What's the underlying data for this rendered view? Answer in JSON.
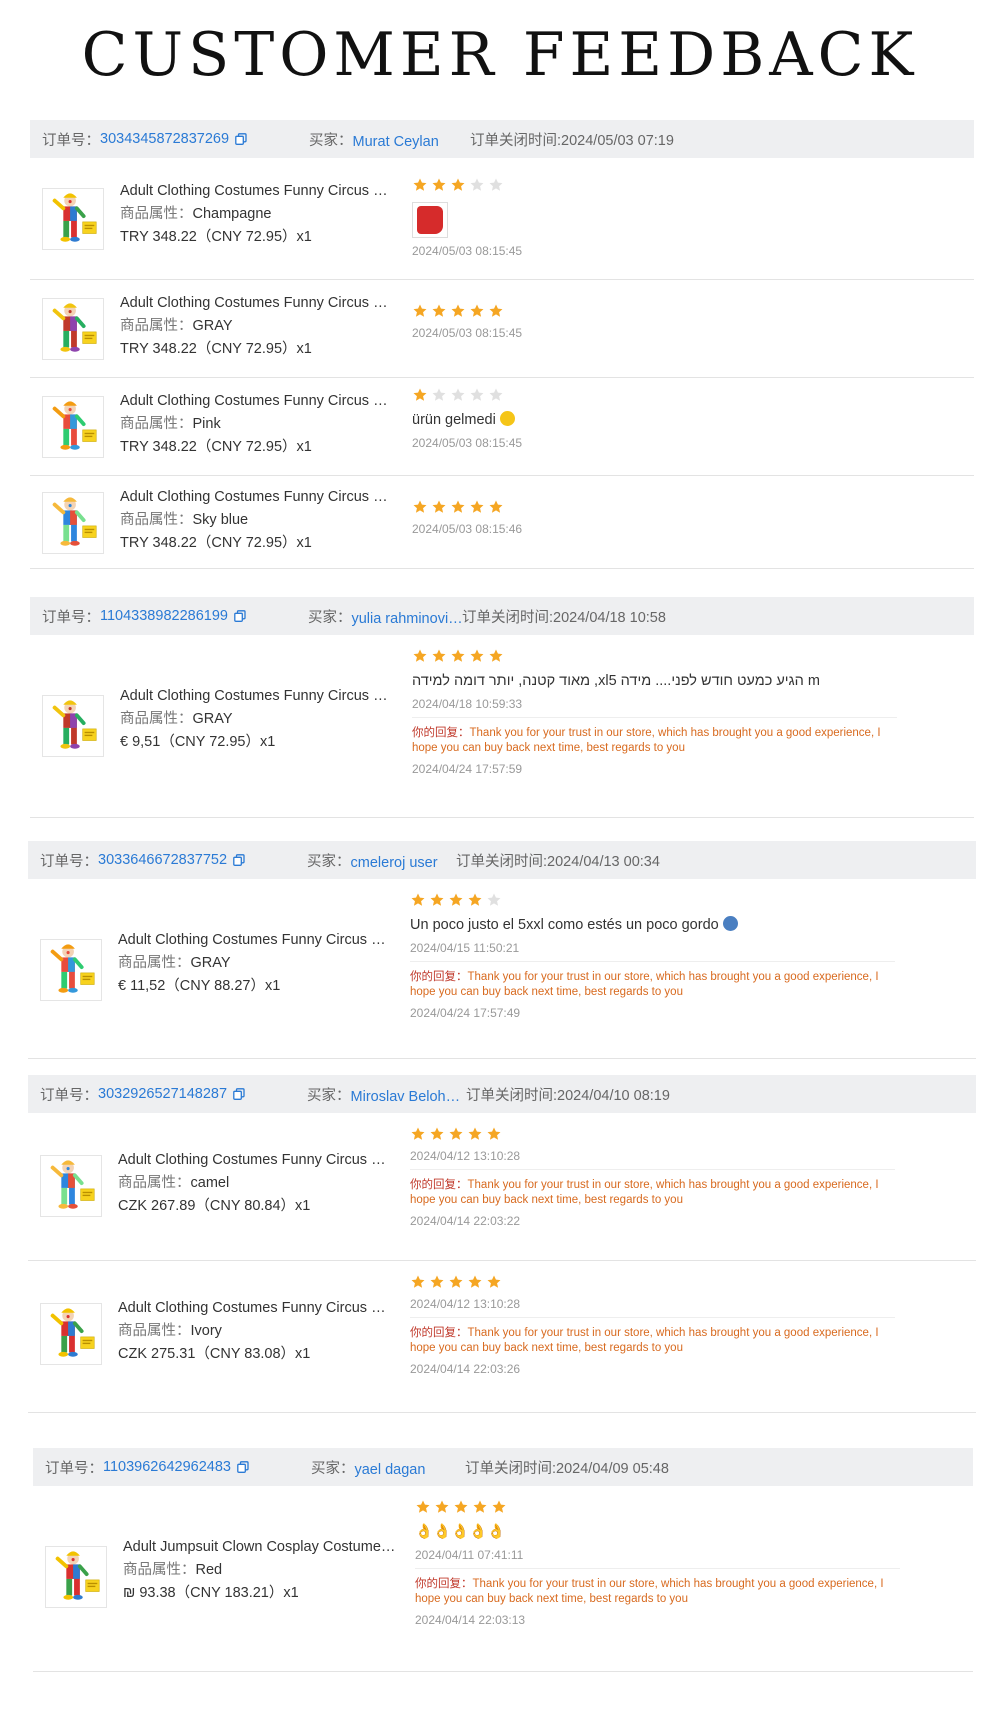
{
  "page": {
    "title": "CUSTOMER FEEDBACK"
  },
  "labels": {
    "order_no": "订单号：",
    "buyer": "买家：",
    "closed": "订单关闭时间:",
    "attr": "商品属性：",
    "reply": "你的回复："
  },
  "colors": {
    "link": "#2a7ad5",
    "star": "#f5a623",
    "star_empty": "#e0e0e0",
    "reply": "#d86a1f",
    "header_bg": "#eeeff1"
  },
  "orders": [
    {
      "order_no": "3034345872837269",
      "buyer": "Murat Ceylan",
      "closed_time": "2024/05/03 07:19",
      "items": [
        {
          "name": "Adult Clothing Costumes Funny Circus Costume",
          "attr": "Champagne",
          "price": "TRY 348.22（CNY  72.95）x1",
          "rating": 3,
          "text": "",
          "has_photo": true,
          "date": "2024/05/03 08:15:45"
        },
        {
          "name": "Adult Clothing Costumes Funny Circus Costume",
          "attr": "GRAY",
          "price": "TRY 348.22（CNY  72.95）x1",
          "rating": 5,
          "text": "",
          "date": "2024/05/03 08:15:45"
        },
        {
          "name": "Adult Clothing Costumes Funny Circus Costume",
          "attr": "Pink",
          "price": "TRY 348.22（CNY  72.95）x1",
          "rating": 1,
          "text": "ürün gelmedi",
          "emoji": "disappointed-face-emoji",
          "date": "2024/05/03 08:15:45"
        },
        {
          "name": "Adult Clothing Costumes Funny Circus Costume",
          "attr": "Sky blue",
          "price": "TRY 348.22（CNY  72.95）x1",
          "rating": 5,
          "text": "",
          "date": "2024/05/03 08:15:46"
        }
      ]
    },
    {
      "order_no": "1104338982286199",
      "buyer": "yulia rahminovich",
      "closed_time": "2024/04/18 10:58",
      "items": [
        {
          "name": "Adult Clothing Costumes Funny Circus Costume",
          "attr": "GRAY",
          "price": "€ 9,51（CNY  72.95）x1",
          "rating": 5,
          "text": "מאוד קטנה, יותר דומה למידה ,xlהגיע כמעט חודש לפני.... מידה 5 m",
          "date": "2024/04/18 10:59:33",
          "reply": "Thank you for your trust in our store, which has brought you a good experience, I hope you can buy back next time, best regards to you",
          "reply_date": "2024/04/24 17:57:59"
        }
      ]
    },
    {
      "order_no": "3033646672837752",
      "buyer": "cmeleroj user",
      "closed_time": "2024/04/13 00:34",
      "items": [
        {
          "name": "Adult Clothing Costumes Funny Circus Costume",
          "attr": "GRAY",
          "price": "€ 11,52（CNY  88.27）x1",
          "rating": 4,
          "text": "Un poco justo el 5xxl como estés un poco gordo",
          "emoji": "person-shrugging-emoji",
          "date": "2024/04/15 11:50:21",
          "reply": "Thank you for your trust in our store, which has brought you a good experience, I hope you can buy back next time, best regards to you",
          "reply_date": "2024/04/24 17:57:49"
        }
      ]
    },
    {
      "order_no": "3032926527148287",
      "buyer": "Miroslav Belohradsky",
      "closed_time": "2024/04/10 08:19",
      "items": [
        {
          "name": "Adult Clothing Costumes Funny Circus Costume",
          "attr": "camel",
          "price": "CZK 267.89（CNY  80.84）x1",
          "rating": 5,
          "text": "",
          "date": "2024/04/12 13:10:28",
          "reply": "Thank you for your trust in our store, which has brought you a good experience, I hope you can buy back next time, best regards to you",
          "reply_date": "2024/04/14 22:03:22"
        },
        {
          "name": "Adult Clothing Costumes Funny Circus Costume",
          "attr": "Ivory",
          "price": "CZK 275.31（CNY  83.08）x1",
          "rating": 5,
          "text": "",
          "date": "2024/04/12 13:10:28",
          "reply": "Thank you for your trust in our store, which has brought you a good experience, I hope you can buy back next time, best regards to you",
          "reply_date": "2024/04/14 22:03:26"
        }
      ]
    },
    {
      "order_no": "1103962642962483",
      "buyer": "yael dagan",
      "closed_time": "2024/04/09 05:48",
      "items": [
        {
          "name": "Adult Jumpsuit Clown Cosplay Costume Stage Performance",
          "attr": "Red",
          "price": "₪ 93.38（CNY  183.21）x1",
          "rating": 5,
          "text": "👌👌👌👌👌",
          "date": "2024/04/11 07:41:11",
          "reply": "Thank you for your trust in our store, which has brought you a good experience, I hope you can buy back next time, best regards to you",
          "reply_date": "2024/04/14 22:03:13"
        }
      ]
    }
  ]
}
